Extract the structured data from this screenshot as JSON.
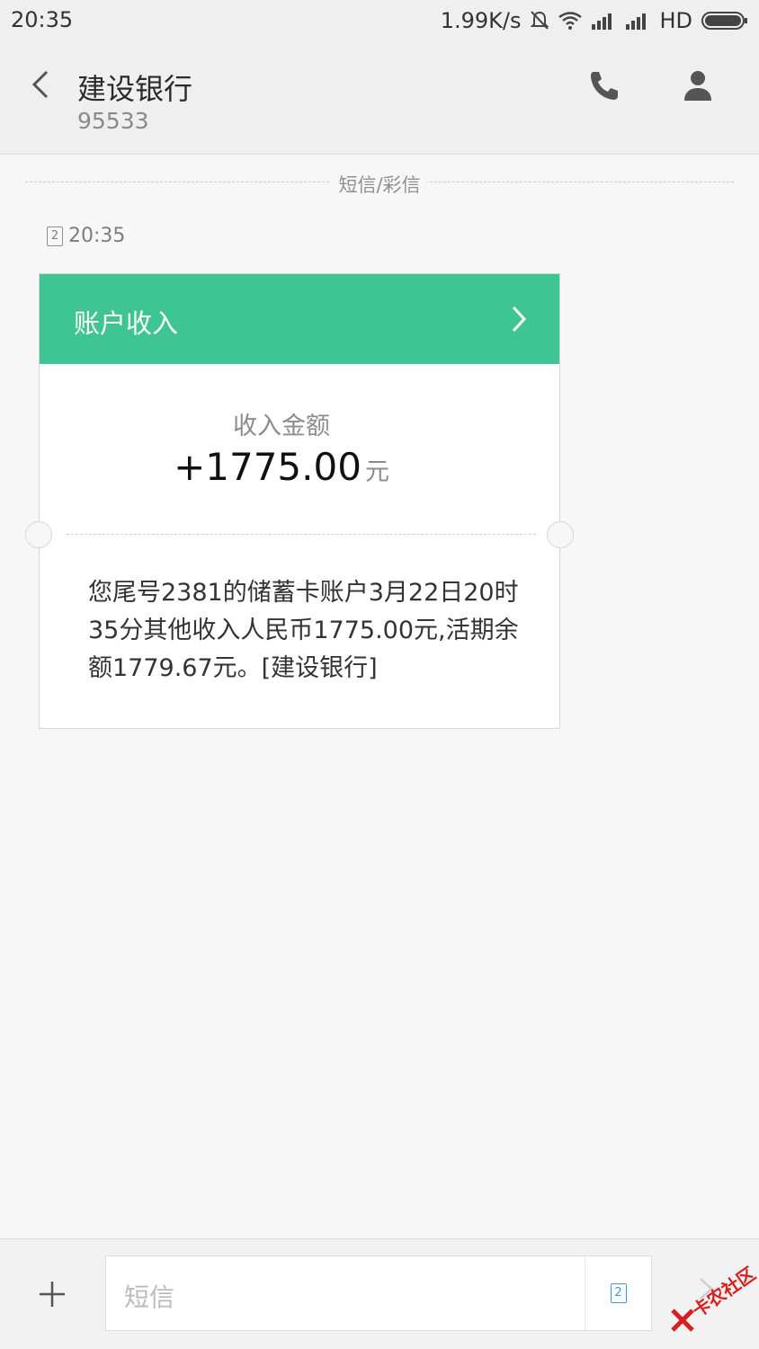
{
  "status_bar": {
    "time": "20:35",
    "net_speed": "1.99K/s",
    "network": "HD"
  },
  "header": {
    "title": "建设银行",
    "number": "95533"
  },
  "divider_label": "短信/彩信",
  "message": {
    "sim": "2",
    "time": "20:35",
    "card": {
      "title": "账户收入",
      "amount_label": "收入金额",
      "amount": "+1775.00",
      "unit": "元",
      "body": "您尾号2381的储蓄卡账户3月22日20时35分其他收入人民币1775.00元,活期余额1779.67元。[建设银行]"
    }
  },
  "compose": {
    "placeholder": "短信",
    "sim": "2"
  },
  "watermark": "卡农社区",
  "colors": {
    "card_header": "#3fc493",
    "sim_accent": "#3b98e0"
  }
}
